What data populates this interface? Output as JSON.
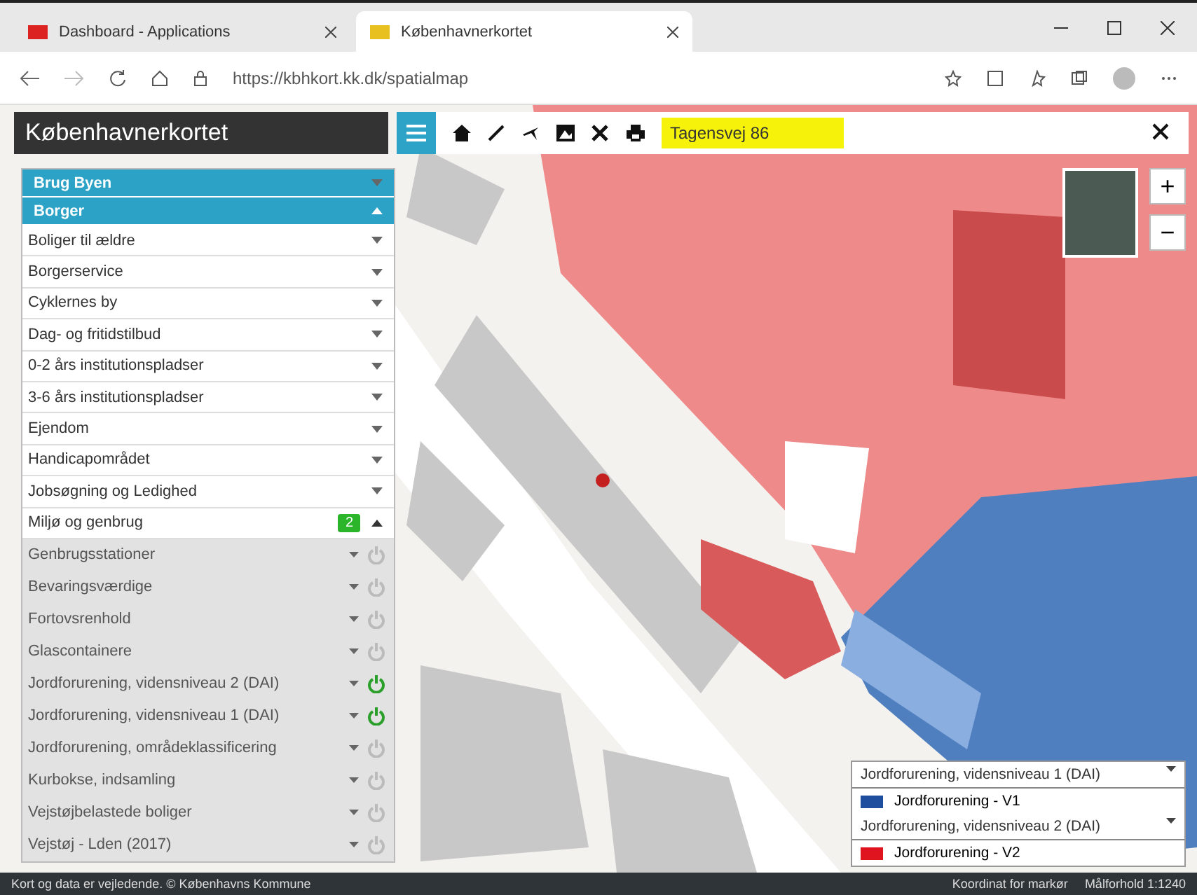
{
  "browser": {
    "tabs": [
      {
        "title": "Dashboard - Applications",
        "selected": false
      },
      {
        "title": "Københavnerkortet",
        "selected": true
      }
    ],
    "url": "https://kbhkort.kk.dk/spatialmap"
  },
  "app": {
    "title": "Københavnerkortet",
    "search": {
      "value": "Tagensvej 86"
    },
    "zoom_in": "+",
    "zoom_out": "−"
  },
  "layers": [
    {
      "label": "Brug Byen",
      "expanded": false
    },
    {
      "label": "Borger",
      "expanded": true,
      "children": [
        {
          "label": "Boliger til ældre",
          "expanded": false
        },
        {
          "label": "Borgerservice",
          "expanded": false
        },
        {
          "label": "Cyklernes by",
          "expanded": false
        },
        {
          "label": "Dag- og fritidstilbud",
          "expanded": false
        },
        {
          "label": "0-2 års institutionspladser",
          "expanded": false
        },
        {
          "label": "3-6 års institutionspladser",
          "expanded": false
        },
        {
          "label": "Ejendom",
          "expanded": false
        },
        {
          "label": "Handicapområdet",
          "expanded": false
        },
        {
          "label": "Jobsøgning og Ledighed",
          "expanded": false
        },
        {
          "label": "Miljø og genbrug",
          "expanded": true,
          "badge": "2",
          "children": [
            {
              "label": "Genbrugsstationer",
              "on": false
            },
            {
              "label": "Bevaringsværdige",
              "on": false
            },
            {
              "label": "Fortovsrenhold",
              "on": false
            },
            {
              "label": "Glascontainere",
              "on": false
            },
            {
              "label": "Jordforurening, vidensniveau 2 (DAI)",
              "on": true
            },
            {
              "label": "Jordforurening, vidensniveau 1 (DAI)",
              "on": true
            },
            {
              "label": "Jordforurening, områdeklassificering",
              "on": false
            },
            {
              "label": "Kurbokse, indsamling",
              "on": false
            },
            {
              "label": "Vejstøjbelastede boliger",
              "on": false
            },
            {
              "label": "Vejstøj - Lden (2017)",
              "on": false
            }
          ]
        }
      ]
    }
  ],
  "legend": [
    {
      "title": "Jordforurening, vidensniveau 1 (DAI)",
      "items": [
        {
          "label": "Jordforurening - V1",
          "color": "#1f4e9e"
        }
      ]
    },
    {
      "title": "Jordforurening, vidensniveau 2 (DAI)",
      "items": [
        {
          "label": "Jordforurening - V2",
          "color": "#e0141e"
        }
      ]
    }
  ],
  "status_bar": {
    "credit": "Kort og data er vejledende. © Københavns Kommune",
    "coordinate_link": "Koordinat for markør",
    "scale": "Målforhold 1:1240"
  }
}
